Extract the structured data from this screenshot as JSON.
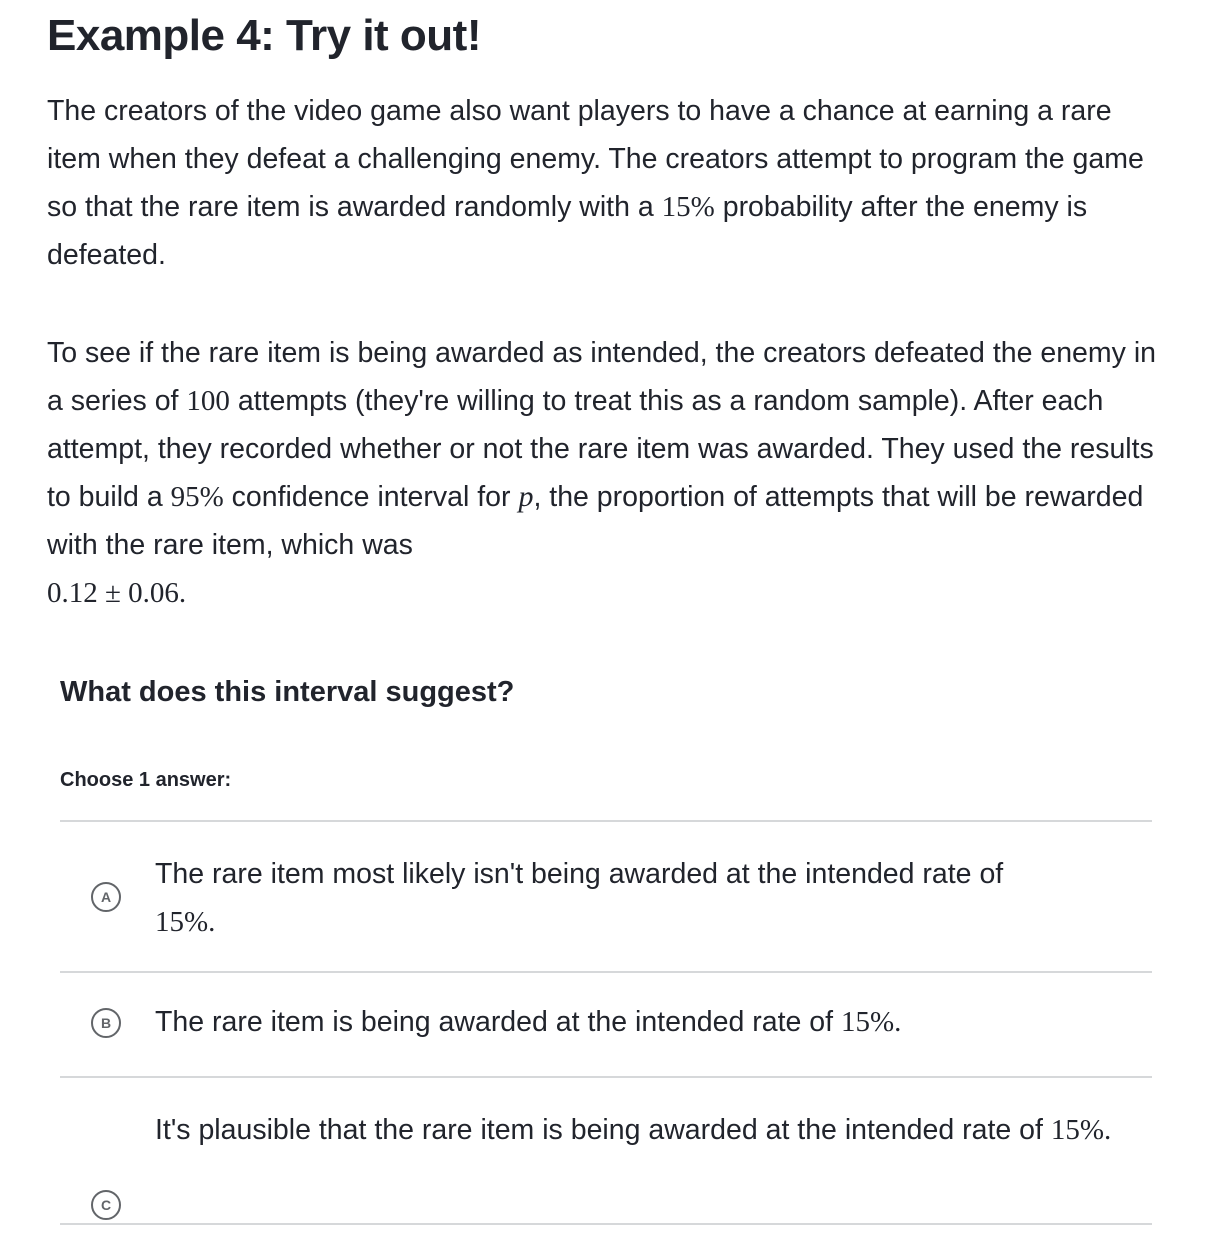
{
  "title": "Example 4: Try it out!",
  "paragraph1": {
    "part1": "The creators of the video game also want players to have a chance at earning a rare item when they defeat a challenging enemy. The creators attempt to program the game so that the rare item is awarded randomly with a ",
    "math1": "15%",
    "part2": " probability after the enemy is defeated."
  },
  "paragraph2": {
    "part1": "To see if the rare item is being awarded as intended, the creators defeated the enemy in a series of ",
    "math1": "100",
    "part2": " attempts (they're willing to treat this as a random sample). After each attempt, they recorded whether or not the rare item was awarded. They used the results to build a ",
    "math2": "95%",
    "part3": " confidence interval for ",
    "math3": "p",
    "part4": ", the proportion of attempts that will be rewarded with the rare item, which was ",
    "math4": "0.12 ± 0.06",
    "part5": "."
  },
  "question": "What does this interval suggest?",
  "choose_label": "Choose 1 answer:",
  "choices": [
    {
      "letter": "A",
      "text": "The rare item most likely isn't being awarded at the intended rate of ",
      "math": "15%",
      "end": "."
    },
    {
      "letter": "B",
      "text": "The rare item is being awarded at the intended rate of ",
      "math": "15%",
      "end": "."
    },
    {
      "letter": "C",
      "text": "It's plausible that the rare item is being awarded at the intended rate of ",
      "math": "15%",
      "end": "."
    }
  ]
}
